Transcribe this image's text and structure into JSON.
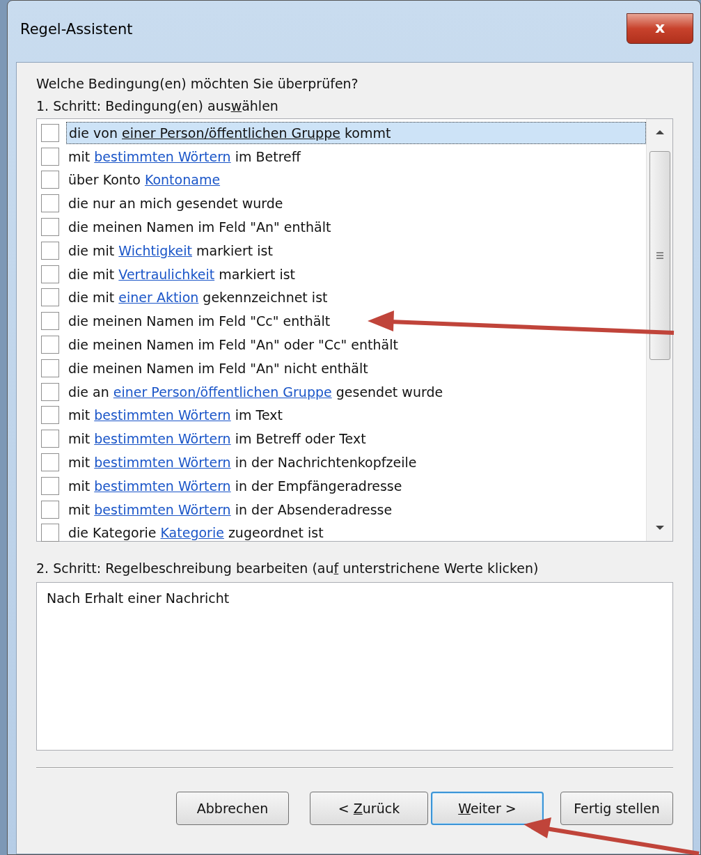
{
  "window": {
    "title": "Regel-Assistent",
    "close_label": "x"
  },
  "question": "Welche Bedingung(en) möchten Sie überprüfen?",
  "step1_label": {
    "before": "1. Schritt: Bedingung(en) aus",
    "accel": "w",
    "after": "ählen"
  },
  "conditions": [
    {
      "before": "die von ",
      "link": "einer Person/öffentlichen Gruppe",
      "after": " kommt",
      "checked": false,
      "selected": true
    },
    {
      "before": "mit ",
      "link": "bestimmten Wörtern",
      "after": " im Betreff",
      "checked": false,
      "selected": false
    },
    {
      "before": "über Konto ",
      "link": "Kontoname",
      "checked": false,
      "selected": false
    },
    {
      "before": "die nur an mich gesendet wurde",
      "checked": false,
      "selected": false
    },
    {
      "before": "die meinen Namen im Feld \"An\" enthält",
      "checked": false,
      "selected": false
    },
    {
      "before": "die mit ",
      "link": "Wichtigkeit",
      "after": " markiert ist",
      "checked": false,
      "selected": false
    },
    {
      "before": "die mit ",
      "link": "Vertraulichkeit",
      "after": " markiert ist",
      "checked": false,
      "selected": false
    },
    {
      "before": "die mit ",
      "link": "einer Aktion",
      "after": " gekennzeichnet ist",
      "checked": false,
      "selected": false
    },
    {
      "before": "die meinen Namen im Feld \"Cc\" enthält",
      "checked": false,
      "selected": false
    },
    {
      "before": "die meinen Namen im Feld \"An\" oder \"Cc\" enthält",
      "checked": false,
      "selected": false
    },
    {
      "before": "die meinen Namen im Feld \"An\" nicht enthält",
      "checked": false,
      "selected": false
    },
    {
      "before": "die an ",
      "link": "einer Person/öffentlichen Gruppe",
      "after": " gesendet wurde",
      "checked": false,
      "selected": false
    },
    {
      "before": "mit ",
      "link": "bestimmten Wörtern",
      "after": " im Text",
      "checked": false,
      "selected": false
    },
    {
      "before": "mit ",
      "link": "bestimmten Wörtern",
      "after": " im Betreff oder Text",
      "checked": false,
      "selected": false
    },
    {
      "before": "mit ",
      "link": "bestimmten Wörtern",
      "after": " in der Nachrichtenkopfzeile",
      "checked": false,
      "selected": false
    },
    {
      "before": "mit ",
      "link": "bestimmten Wörtern",
      "after": " in der Empfängeradresse",
      "checked": false,
      "selected": false
    },
    {
      "before": "mit ",
      "link": "bestimmten Wörtern",
      "after": " in der Absenderadresse",
      "checked": false,
      "selected": false
    },
    {
      "before": "die Kategorie ",
      "link": "Kategorie",
      "after": " zugeordnet ist",
      "checked": false,
      "selected": false
    }
  ],
  "step2_label": {
    "before": "2. Schritt: Regelbeschreibung bearbeiten (au",
    "accel": "f",
    "after": " unterstrichene Werte klicken)"
  },
  "description": "Nach Erhalt einer Nachricht",
  "buttons": [
    {
      "before": "Abbrechen",
      "default": false
    },
    {
      "before": "< ",
      "accel": "Z",
      "after": "urück",
      "default": false
    },
    {
      "accel": "W",
      "after": "eiter >",
      "default": true
    },
    {
      "before": "Fertig stellen",
      "default": false
    }
  ]
}
